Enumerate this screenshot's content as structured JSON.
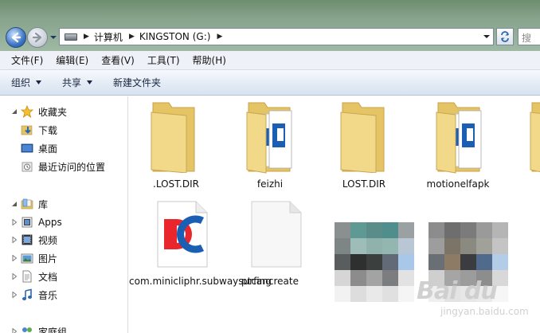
{
  "address_bar": {
    "breadcrumbs": [
      "计算机",
      "KINGSTON (G:)"
    ],
    "search_placeholder": "搜"
  },
  "menu": {
    "items": [
      "文件(F)",
      "编辑(E)",
      "查看(V)",
      "工具(T)",
      "帮助(H)"
    ]
  },
  "command_bar": {
    "organize": "组织",
    "share": "共享",
    "new_folder": "新建文件夹"
  },
  "nav_pane": {
    "favorites": {
      "label": "收藏夹",
      "items": [
        "下载",
        "桌面",
        "最近访问的位置"
      ]
    },
    "libraries": {
      "label": "库",
      "items": [
        "Apps",
        "视频",
        "图片",
        "文档",
        "音乐"
      ]
    },
    "homegroup": {
      "label": "家庭组"
    }
  },
  "files": [
    {
      "name": ".LOST.DIR",
      "type": "folder-empty"
    },
    {
      "name": "feizhi",
      "type": "folder-docs"
    },
    {
      "name": "LOST.DIR",
      "type": "folder-empty"
    },
    {
      "name": "motionelfapk",
      "type": "folder-docs"
    },
    {
      "name": "com.minicliphr.subwaysurfing",
      "type": "dc-file"
    },
    {
      "name": "ptcancreate",
      "type": "blank-file"
    },
    {
      "name": "",
      "type": "pixelated"
    },
    {
      "name": "",
      "type": "pixelated"
    }
  ],
  "watermark": {
    "logo": "Bai du",
    "sub": "jingyan.baidu.com"
  },
  "colors": {
    "folder_front": "#f2d98a",
    "folder_back": "#e5c466",
    "dc_red": "#e8262b",
    "dc_blue": "#1a5fb4",
    "selection_blue": "#3d76c7"
  }
}
